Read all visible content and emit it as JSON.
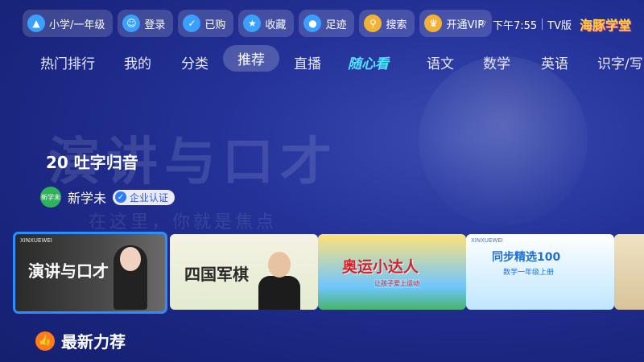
{
  "topbar": {
    "items": [
      {
        "label": "小学/一年级",
        "icon": "grade-icon"
      },
      {
        "label": "登录",
        "icon": "login-icon"
      },
      {
        "label": "已购",
        "icon": "purchased-icon"
      },
      {
        "label": "收藏",
        "icon": "favorite-icon"
      },
      {
        "label": "足迹",
        "icon": "history-icon"
      },
      {
        "label": "搜索",
        "icon": "search-icon"
      },
      {
        "label": "开通VIP",
        "icon": "vip-icon"
      }
    ],
    "time": "下午7:55",
    "version": "TV版",
    "brand": "海豚学堂"
  },
  "nav": {
    "tabs": [
      "热门排行",
      "我的",
      "分类",
      "推荐",
      "直播",
      "随心看",
      "语文",
      "数学",
      "英语",
      "识字/写"
    ],
    "active": "推荐"
  },
  "hero": {
    "bg_text": "演讲与口才",
    "bg_subtext": "在这里，你就是焦点",
    "title": "20 吐字归音",
    "author_avatar": "新学未",
    "author": "新学未",
    "badge": "企业认证"
  },
  "cards": [
    {
      "tag": "XINXUEWEI",
      "title": "演讲与口才"
    },
    {
      "tag": "",
      "title": "四国军棋"
    },
    {
      "tag": "",
      "title": "奥运小达人",
      "sub": "让孩子爱上运动"
    },
    {
      "tag": "XINXUEWEI",
      "title": "同步精选100",
      "sub": "数学一年级上册"
    },
    {
      "tag": "",
      "title": ""
    }
  ],
  "section": {
    "title": "最新力荐"
  },
  "colors": {
    "accent": "#2d8dff",
    "bg": "#1d2a86"
  }
}
